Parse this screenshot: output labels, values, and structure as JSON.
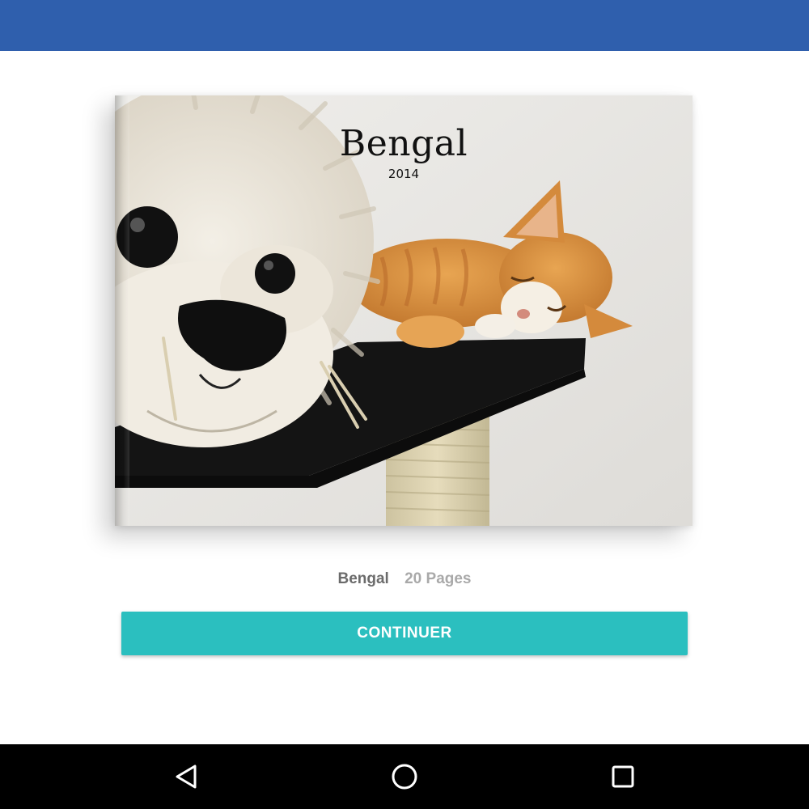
{
  "cover": {
    "title": "Bengal",
    "year": "2014",
    "image": "photo of orange kitten sleeping on cat tree next to plush lion"
  },
  "book_info": {
    "name": "Bengal",
    "pages": "20 Pages"
  },
  "actions": {
    "continue_label": "CONTINUER"
  },
  "navigation": {
    "back": "back-icon",
    "home": "home-icon",
    "recents": "recents-icon"
  },
  "colors": {
    "app_bar": "#2f5fad",
    "accent": "#2bbfbf",
    "nav_bar": "#000000"
  }
}
